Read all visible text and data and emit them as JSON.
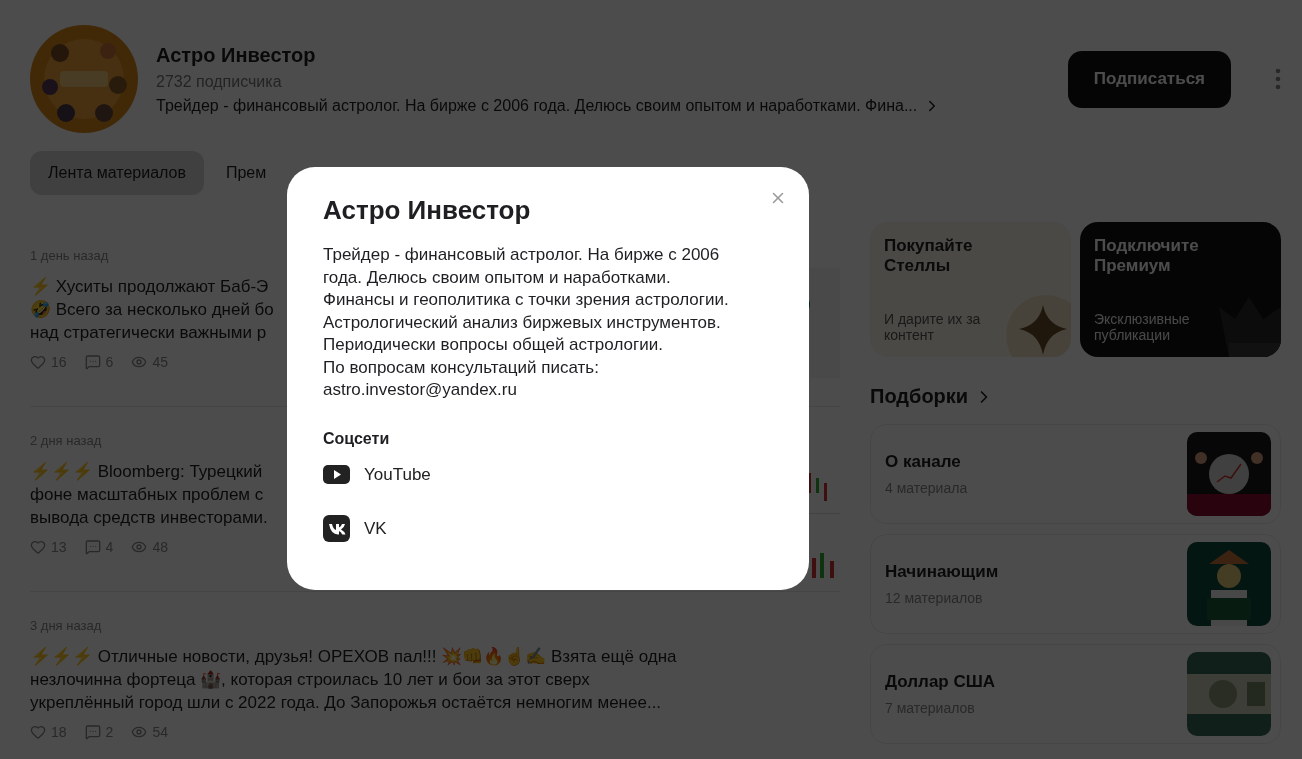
{
  "channel": {
    "name": "Астро Инвестор",
    "subscribers": "2732 подписчика",
    "description": "Трейдер - финансовый астролог. На бирже с 2006 года. Делюсь своим опытом и наработками. Фина..."
  },
  "subscribe_button": "Подписаться",
  "tabs": [
    {
      "label": "Лента материалов",
      "selected": true
    },
    {
      "label": "Прем",
      "selected": false
    }
  ],
  "posts": [
    {
      "date": "1 день назад",
      "lines": [
        "⚡ Хуситы продолжают Баб-Э",
        "🤣 Всего за несколько дней бо",
        "над стратегически важными р"
      ],
      "likes": "16",
      "comments": "6",
      "views": "45",
      "kind": "picture"
    },
    {
      "date": "2 дня назад",
      "lines": [
        "⚡⚡⚡ Bloomberg: Турецкий",
        "фоне масштабных проблем с",
        "вывода средств инвесторами."
      ],
      "likes": "13",
      "comments": "4",
      "views": "48",
      "kind": "picture"
    },
    {
      "date": "3 дня назад",
      "lines": [
        "⚡⚡⚡ Отличные новости, друзья! ОРЕХОВ пал!!! 💥👊🔥☝✍ Взята ещё одна",
        "незлочинна фортеца 🏰, которая строилась 10 лет и бои за этот сверх",
        "укреплённый город шли с 2022 года. До Запорожья остаётся немногим менее..."
      ],
      "likes": "18",
      "comments": "2",
      "views": "54"
    }
  ],
  "promos": [
    {
      "kind": "stars",
      "title": "Покупайте Стеллы",
      "subtitle": "И дарите их за контент"
    },
    {
      "kind": "premium",
      "title": "Подключите Премиум",
      "subtitle": "Эксклюзивные публикации"
    }
  ],
  "collections_heading": "Подборки",
  "collections": [
    {
      "title": "О канале",
      "count": "4 материала",
      "kind": "picture"
    },
    {
      "title": "Начинающим",
      "count": "12 материалов",
      "kind": "picture"
    },
    {
      "title": "Доллар США",
      "count": "7 материалов",
      "kind": "picture"
    }
  ],
  "modal": {
    "title": "Астро Инвестор",
    "description": [
      "Трейдер - финансовый астролог. На бирже с 2006 года. Делюсь своим опытом и наработками.",
      "Финансы и геополитика с точки зрения астрологии.",
      "Астрологический анализ биржевых инструментов.",
      "Периодически вопросы общей астрологии.",
      "По вопросам консультаций писать:",
      "astro.investor@yandex.ru"
    ],
    "socials_heading": "Соцсети",
    "socials": [
      {
        "kind": "youtube",
        "label": "YouTube"
      },
      {
        "kind": "vk",
        "label": "VK"
      }
    ]
  }
}
